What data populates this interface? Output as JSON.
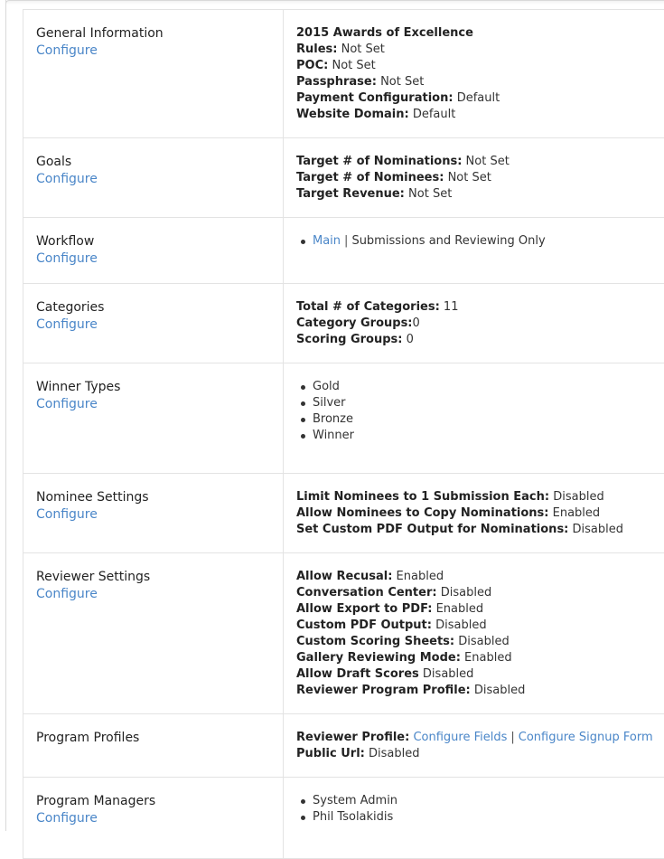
{
  "configure_label": "Configure",
  "general": {
    "title": "General Information",
    "program_name": "2015 Awards of Excellence",
    "rows": [
      {
        "k": "Rules:",
        "v": "Not Set"
      },
      {
        "k": "POC:",
        "v": "Not Set"
      },
      {
        "k": "Passphrase:",
        "v": "Not Set"
      },
      {
        "k": "Payment Configuration:",
        "v": "Default"
      },
      {
        "k": "Website Domain:",
        "v": "Default"
      }
    ]
  },
  "goals": {
    "title": "Goals",
    "rows": [
      {
        "k": "Target # of Nominations:",
        "v": "Not Set"
      },
      {
        "k": "Target # of Nominees:",
        "v": "Not Set"
      },
      {
        "k": "Target Revenue:",
        "v": "Not Set"
      }
    ]
  },
  "workflow": {
    "title": "Workflow",
    "items": [
      {
        "link": "Main",
        "sep": "|",
        "text": "Submissions and Reviewing Only"
      }
    ]
  },
  "categories": {
    "title": "Categories",
    "rows": [
      {
        "k": "Total # of Categories:",
        "v": "11"
      },
      {
        "k": "Category Groups:",
        "v": "0"
      },
      {
        "k": "Scoring Groups:",
        "v": "0"
      }
    ]
  },
  "winner_types": {
    "title": "Winner Types",
    "items": [
      "Gold",
      "Silver",
      "Bronze",
      "Winner"
    ]
  },
  "nominee_settings": {
    "title": "Nominee Settings",
    "rows": [
      {
        "k": "Limit Nominees to 1 Submission Each:",
        "v": "Disabled"
      },
      {
        "k": "Allow Nominees to Copy Nominations:",
        "v": "Enabled"
      },
      {
        "k": "Set Custom PDF Output for Nominations:",
        "v": "Disabled"
      }
    ]
  },
  "reviewer_settings": {
    "title": "Reviewer Settings",
    "rows": [
      {
        "k": "Allow Recusal:",
        "v": "Enabled"
      },
      {
        "k": "Conversation Center:",
        "v": "Disabled"
      },
      {
        "k": "Allow Export to PDF:",
        "v": "Enabled"
      },
      {
        "k": "Custom PDF Output:",
        "v": "Disabled"
      },
      {
        "k": "Custom Scoring Sheets:",
        "v": "Disabled"
      },
      {
        "k": "Gallery Reviewing Mode:",
        "v": "Enabled"
      },
      {
        "k": "Allow Draft Scores",
        "v": "Disabled"
      },
      {
        "k": "Reviewer Program Profile:",
        "v": "Disabled"
      }
    ]
  },
  "program_profiles": {
    "title": "Program Profiles",
    "reviewer_profile_key": "Reviewer Profile:",
    "configure_fields": "Configure Fields",
    "sep": "|",
    "configure_signup": "Configure Signup Form",
    "public_url_key": "Public Url:",
    "public_url_value": "Disabled"
  },
  "program_managers": {
    "title": "Program Managers",
    "items": [
      "System Admin",
      "Phil Tsolakidis"
    ]
  },
  "colors": {
    "link": "#4a86c8",
    "border": "#e3e3e3",
    "text": "#333333"
  }
}
